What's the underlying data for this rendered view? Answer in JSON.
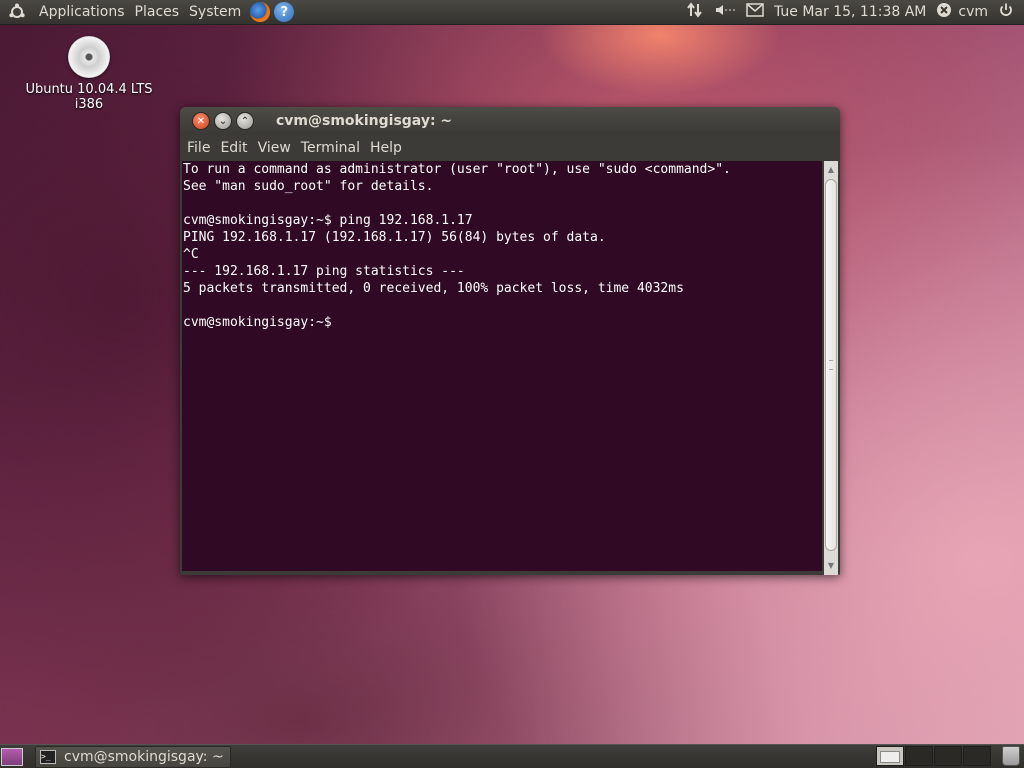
{
  "top_panel": {
    "menus": [
      "Applications",
      "Places",
      "System"
    ],
    "clock": "Tue Mar 15, 11:38 AM",
    "user": "cvm"
  },
  "desktop": {
    "icon_label_line1": "Ubuntu 10.04.4 LTS",
    "icon_label_line2": "i386"
  },
  "window": {
    "title": "cvm@smokingisgay: ~",
    "menus": [
      "File",
      "Edit",
      "View",
      "Terminal",
      "Help"
    ],
    "terminal_lines": [
      "To run a command as administrator (user \"root\"), use \"sudo <command>\".",
      "See \"man sudo_root\" for details.",
      "",
      "cvm@smokingisgay:~$ ping 192.168.1.17",
      "PING 192.168.1.17 (192.168.1.17) 56(84) bytes of data.",
      "^C",
      "--- 192.168.1.17 ping statistics ---",
      "5 packets transmitted, 0 received, 100% packet loss, time 4032ms",
      "",
      "cvm@smokingisgay:~$ "
    ]
  },
  "bottom_panel": {
    "task_title": "cvm@smokingisgay: ~"
  },
  "colors": {
    "terminal_bg": "#300a24",
    "panel_bg": "#3c3b37",
    "close_button": "#d2451e"
  },
  "icons": {
    "top_left": "ubuntu-logo-icon",
    "launcher_1": "firefox-icon",
    "launcher_2": "help-icon",
    "tray": [
      "network-icon",
      "volume-icon",
      "mail-icon",
      "user-status-icon",
      "power-icon"
    ],
    "desktop": "cd-disc-icon",
    "bottom_left": "show-desktop-icon",
    "bottom_right": "trash-icon"
  }
}
